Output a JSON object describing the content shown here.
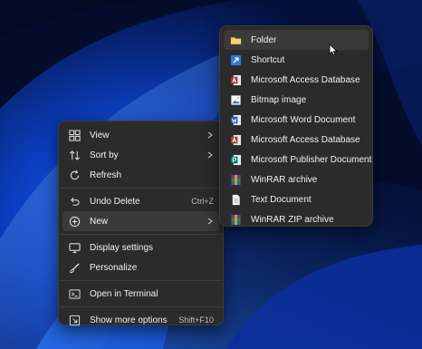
{
  "context_menu": {
    "view_label": "View",
    "sort_by_label": "Sort by",
    "refresh_label": "Refresh",
    "undo_delete_label": "Undo Delete",
    "undo_delete_shortcut": "Ctrl+Z",
    "new_label": "New",
    "display_settings_label": "Display settings",
    "personalize_label": "Personalize",
    "open_terminal_label": "Open in Terminal",
    "show_more_label": "Show more options",
    "show_more_shortcut": "Shift+F10"
  },
  "new_submenu": {
    "items": [
      {
        "label": "Folder",
        "icon": "folder-icon"
      },
      {
        "label": "Shortcut",
        "icon": "shortcut-icon"
      },
      {
        "label": "Microsoft Access Database",
        "icon": "access-icon"
      },
      {
        "label": "Bitmap image",
        "icon": "bitmap-icon"
      },
      {
        "label": "Microsoft Word Document",
        "icon": "word-icon"
      },
      {
        "label": "Microsoft Access Database",
        "icon": "access-icon"
      },
      {
        "label": "Microsoft Publisher Document",
        "icon": "publisher-icon"
      },
      {
        "label": "WinRAR archive",
        "icon": "winrar-icon"
      },
      {
        "label": "Text Document",
        "icon": "text-document-icon"
      },
      {
        "label": "WinRAR ZIP archive",
        "icon": "winrar-zip-icon"
      }
    ]
  },
  "colors": {
    "menu_bg": "#2b2b2b",
    "highlight": "#3a3a3a",
    "accent_folder": "#f2c14e",
    "access_red": "#a4373a",
    "word_blue": "#2b579a",
    "publisher_teal": "#077568",
    "shortcut_blue": "#2f7ad9"
  }
}
